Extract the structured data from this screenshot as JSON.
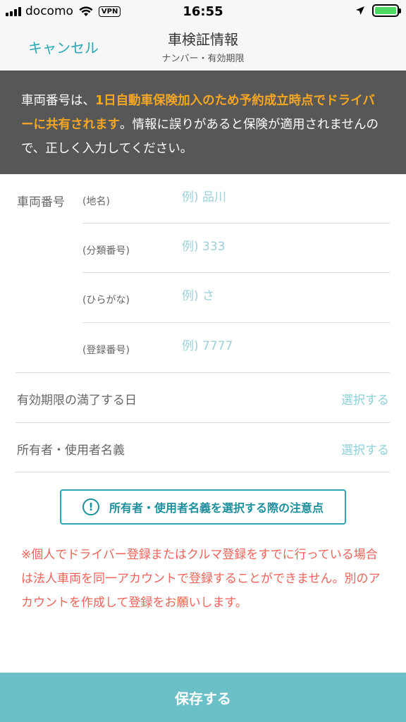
{
  "status_bar": {
    "carrier": "docomo",
    "vpn": "VPN",
    "time": "16:55",
    "battery_level": 1.0,
    "battery_color": "#4cd964"
  },
  "nav": {
    "cancel_label": "キャンセル",
    "title": "車検証情報",
    "subtitle": "ナンバー・有効期限"
  },
  "notice": {
    "part1": "車両番号は、",
    "highlight": "1日自動車保険加入のため予約成立時点でドライバーに共有されます",
    "part2": "。情報に誤りがあると保険が適用されませんので、正しく入力してください。"
  },
  "plate": {
    "label": "車両番号",
    "fields": [
      {
        "label": "(地名)",
        "placeholder": "例) 品川"
      },
      {
        "label": "(分類番号)",
        "placeholder": "例) 333"
      },
      {
        "label": "(ひらがな)",
        "placeholder": "例) さ"
      },
      {
        "label": "(登録番号)",
        "placeholder": "例) 7777"
      }
    ]
  },
  "expiry": {
    "label": "有効期限の満了する日",
    "action": "選択する"
  },
  "owner": {
    "label": "所有者・使用者名義",
    "action": "選択する"
  },
  "caution_button": {
    "icon": "!",
    "label": "所有者・使用者名義を選択する際の注意点"
  },
  "warning": "※個人でドライバー登録またはクルマ登録をすでに行っている場合は法人車両を同一アカウントで登録することができません。別のアカウントを作成して登録をお願いします。",
  "save_label": "保存する",
  "colors": {
    "accent": "#2ba6b5",
    "highlight": "#f5a623",
    "warning": "#f0645a",
    "save_bg": "#6bbfc7"
  }
}
